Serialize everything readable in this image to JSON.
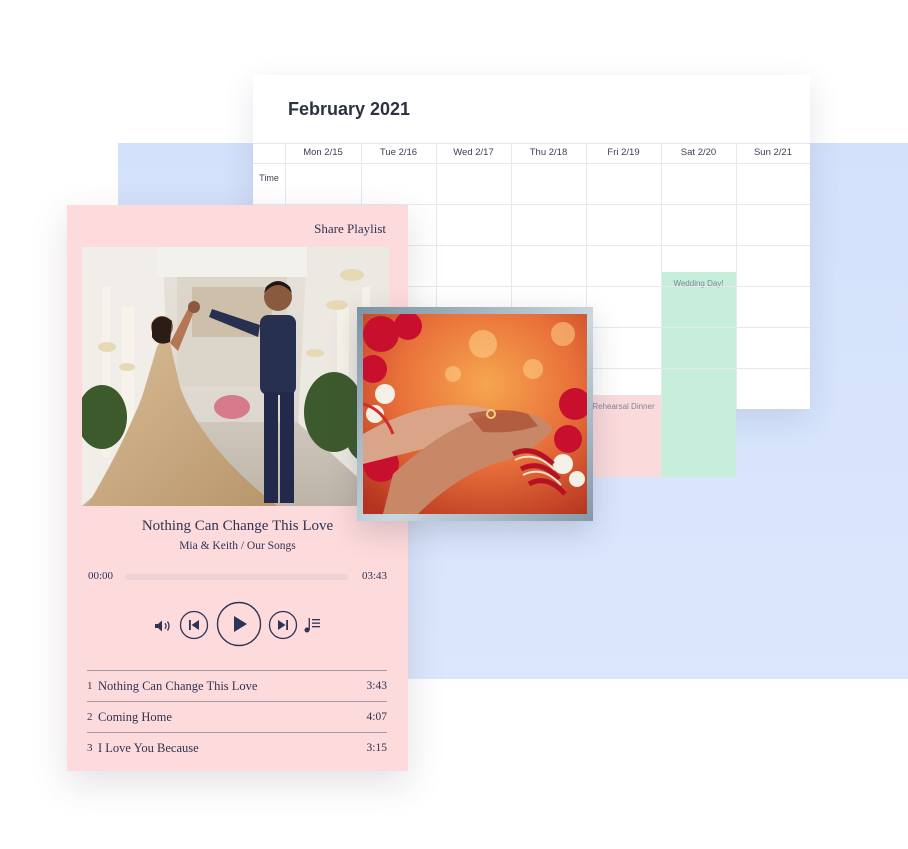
{
  "calendar": {
    "title": "February 2021",
    "time_label": "Time",
    "days": [
      "Mon 2/15",
      "Tue 2/16",
      "Wed 2/17",
      "Thu 2/18",
      "Fri 2/19",
      "Sat 2/20",
      "Sun 2/21"
    ],
    "events": {
      "wedding": "Wedding Day!",
      "rehearsal": "Rehearsal Dinner"
    }
  },
  "player": {
    "share_label": "Share Playlist",
    "now_playing": {
      "title": "Nothing Can Change This Love",
      "subtitle": "Mia & Keith / Our Songs"
    },
    "time_current": "00:00",
    "time_total": "03:43",
    "progress": 0,
    "controls": {
      "volume_icon": "volume-icon",
      "prev_icon": "skip-previous-icon",
      "play_icon": "play-icon",
      "next_icon": "skip-next-icon",
      "playlist_icon": "playlist-icon"
    },
    "tracks": [
      {
        "num": "1",
        "name": "Nothing Can Change This Love",
        "duration": "3:43"
      },
      {
        "num": "2",
        "name": "Coming Home",
        "duration": "4:07"
      },
      {
        "num": "3",
        "name": "I Love You Because",
        "duration": "3:15"
      }
    ]
  },
  "colors": {
    "player_bg": "#fddadb",
    "accent_text": "#2f3455",
    "wedding_event": "#c6eedb",
    "rehearsal_event": "#fadadb",
    "backdrop": "#d3e1fb"
  }
}
